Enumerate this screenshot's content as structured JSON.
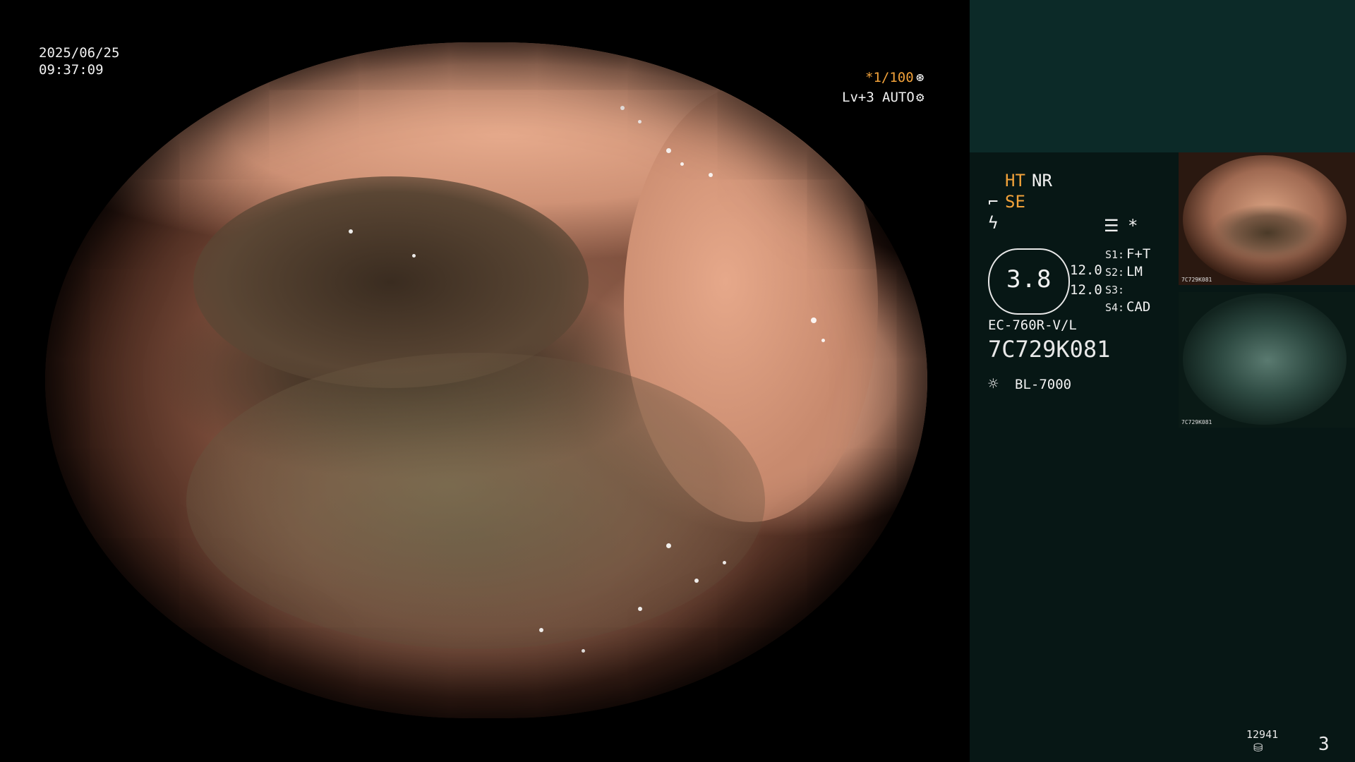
{
  "overlay": {
    "date": "2025/06/25",
    "time": "09:37:09",
    "shutter": "*1/100",
    "level": "Lv+3",
    "mode": "AUTO"
  },
  "settings": {
    "ht": "HT",
    "nr": "NR",
    "se": "SE",
    "zoom_value": "3.8",
    "value_a": "12.0",
    "value_b": "12.0",
    "s1_key": "S1:",
    "s1_val": "F+T",
    "s2_key": "S2:",
    "s2_val": "LM",
    "s3_key": "S3:",
    "s3_val": "",
    "s4_key": "S4:",
    "s4_val": "CAD",
    "asterisk": "*"
  },
  "device": {
    "model": "EC-760R-V/L",
    "serial": "7C729K081",
    "light_source": "BL-7000"
  },
  "thumbnails": [
    {
      "label": "7C729K081"
    },
    {
      "label": "7C729K081"
    }
  ],
  "footer": {
    "storage_count": "12941",
    "page_number": "3"
  },
  "colors": {
    "accent": "#f2a23a",
    "panel_top": "#0c2a28",
    "panel_bg": "#071715"
  },
  "icons": [
    "aperture-icon",
    "gear-icon",
    "fiber-icon",
    "bolt-icon",
    "settings-list-icon",
    "lamp-icon",
    "storage-icon"
  ]
}
